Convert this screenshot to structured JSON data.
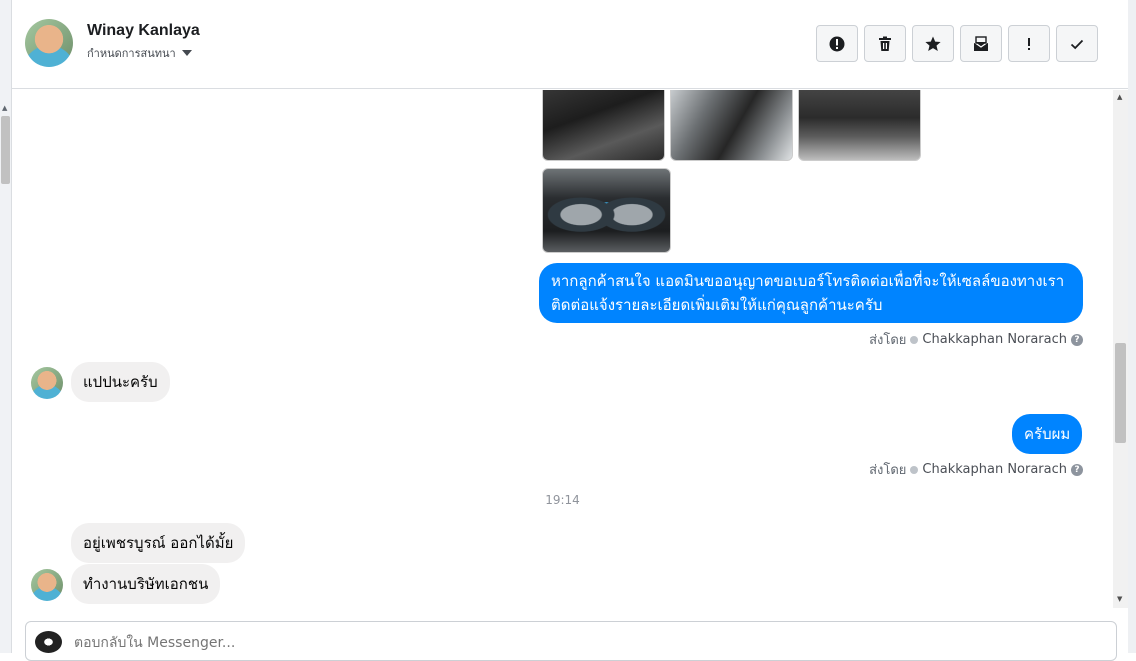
{
  "header": {
    "contact_name": "Winay Kanlaya",
    "assign_label": "กำหนดการสนทนา",
    "toolbar": [
      {
        "icon": "alert-icon",
        "name": "mark-spam-button"
      },
      {
        "icon": "trash-icon",
        "name": "delete-button"
      },
      {
        "icon": "star-icon",
        "name": "star-button"
      },
      {
        "icon": "mark-unread-icon",
        "name": "mark-unread-button"
      },
      {
        "icon": "exclamation-icon",
        "name": "follow-up-button"
      },
      {
        "icon": "check-icon",
        "name": "done-button"
      }
    ]
  },
  "messages": {
    "m1_text": "หากลูกค้าสนใจ แอดมินขออนุญาตขอเบอร์โทรติดต่อเพื่อที่จะให้เซลล์ของทางเราติดต่อแจ้งรายละเอียดเพิ่มเติมให้แก่คุณลูกค้านะครับ",
    "m1_line1": "หากลูกค้าสนใจ แอดมินขออนุญาตขอเบอร์โทรติดต่อเพื่อที่จะให้เซลล์ของทางเรา",
    "m1_line2": "ติดต่อแจ้งรายละเอียดเพิ่มเติมให้แก่คุณลูกค้านะครับ",
    "sent_by_prefix": "ส่งโดย",
    "agent_name": "Chakkaphan Norarach",
    "help_glyph": "?",
    "m2_text": "แปปนะครับ",
    "m3_text": "ครับผม",
    "time_separator": "19:14",
    "m4_text": "อยู่เพชรบูรณ์ ออกได้มั้ย",
    "m5_text": "ทำงานบริษัทเอกชน"
  },
  "composer": {
    "placeholder": "ตอบกลับใน Messenger..."
  },
  "colors": {
    "outgoing_bubble": "#0084ff",
    "incoming_bubble": "#f1f0f0",
    "agent_name": "#4b4f56"
  }
}
